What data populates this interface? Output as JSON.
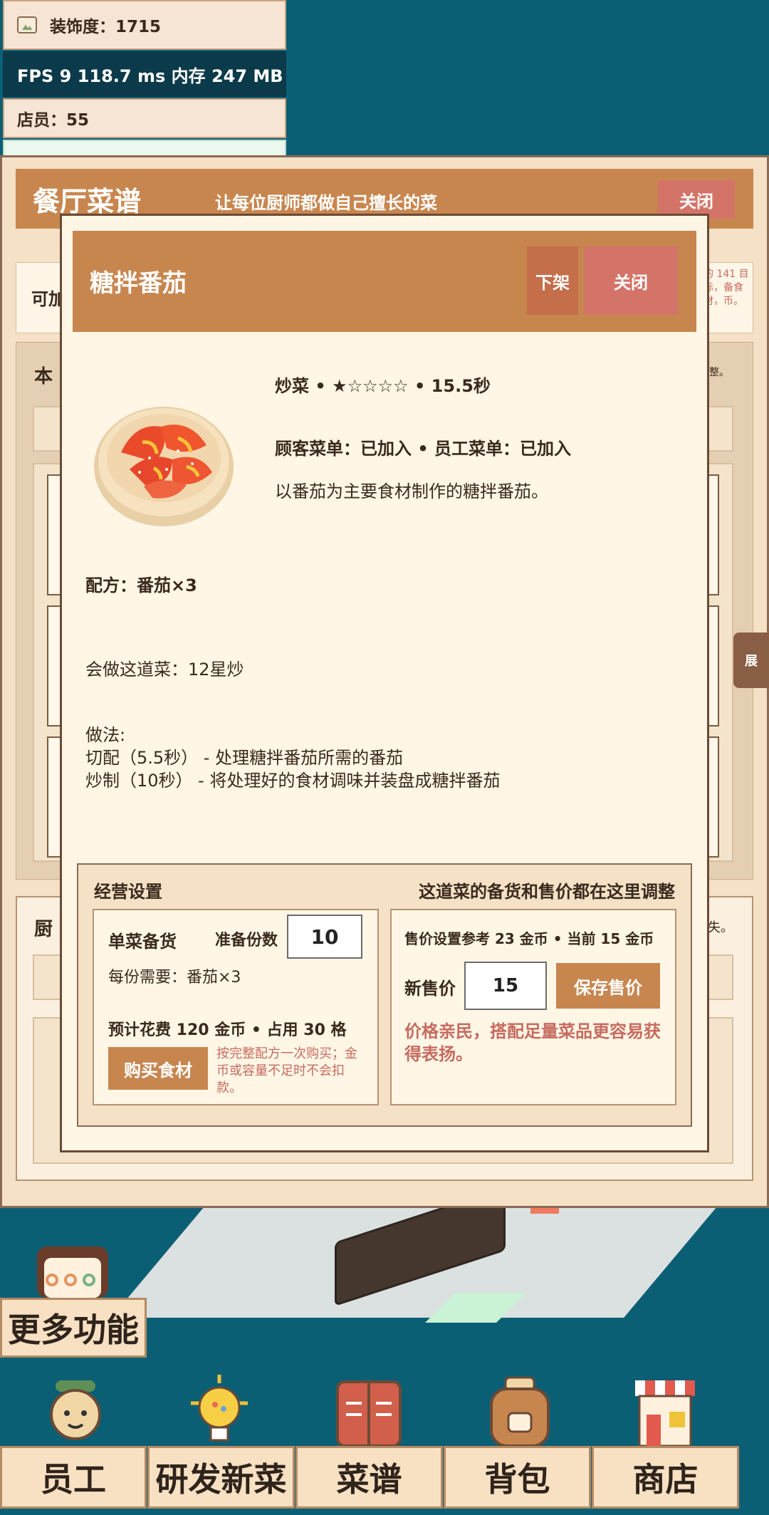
{
  "stats": {
    "decor": "装饰度：1715",
    "fps": "FPS 9   118.7 ms   内存 247 MB",
    "staff": "店员：55"
  },
  "recipes_panel": {
    "title": "餐厅菜谱",
    "subtitle": "让每位厨师都做自己擅长的菜",
    "close_label": "关闭",
    "available_label": "可加",
    "info_right": "的 141 目标，备食材，币。",
    "shop_label": "本",
    "shop_note": "整。",
    "chef_label": "厨",
    "chef_note": "失。",
    "side_tab": "展"
  },
  "dish_modal": {
    "title": "糖拌番茄",
    "offshelf_label": "下架",
    "close_label": "关闭",
    "meta_line": "炒菜 • ★☆☆☆☆ • 15.5秒",
    "menu_status": "顾客菜单：已加入   •   员工菜单：已加入",
    "description": "以番茄为主要食材制作的糖拌番茄。",
    "recipe": "配方：番茄×3",
    "chefs": "会做这道菜：12星炒",
    "method_title": "做法:",
    "steps": [
      "切配（5.5秒） - 处理糖拌番茄所需的番茄",
      "炒制（10秒） - 将处理好的食材调味并装盘成糖拌番茄"
    ]
  },
  "operations": {
    "title": "经营设置",
    "hint": "这道菜的备货和售价都在这里调整",
    "stock": {
      "title": "单菜备货",
      "qty_label": "准备份数",
      "qty_value": "10",
      "need": "每份需要：番茄×3",
      "cost": "预计花费 120 金币 • 占用 30 格",
      "buy_label": "购买食材",
      "buy_note": "按完整配方一次购买；金币或容量不足时不会扣款。"
    },
    "pricing": {
      "ref": "售价设置参考 23 金币 • 当前 15 金币",
      "new_label": "新售价",
      "new_value": "15",
      "save_label": "保存售价",
      "tip": "价格亲民，搭配足量菜品更容易获得表扬。"
    }
  },
  "bottom_nav": {
    "more": "更多功能",
    "items": [
      "员工",
      "研发新菜",
      "菜谱",
      "背包",
      "商店"
    ]
  },
  "colors": {
    "accent": "#c8864f",
    "danger": "#d47469",
    "background": "#0b5f74"
  }
}
